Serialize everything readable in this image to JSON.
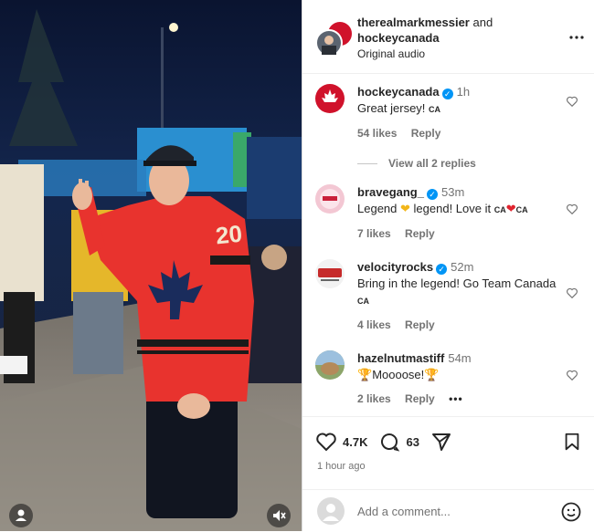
{
  "header": {
    "user1": "therealmarkmessier",
    "joiner": "and",
    "user2": "hockeycanada",
    "audio": "Original audio",
    "more_icon": "more-horizontal-icon"
  },
  "comments": [
    {
      "user": "hockeycanada",
      "verified": true,
      "time": "1h",
      "text": "Great jersey!",
      "flag": "CA",
      "likes": "54 likes",
      "reply": "Reply",
      "view_replies": "View all 2 replies"
    },
    {
      "user": "bravegang_",
      "verified": true,
      "time": "53m",
      "text_a": "Legend",
      "text_b": "legend! Love it",
      "flag": "CA",
      "likes": "7 likes",
      "reply": "Reply"
    },
    {
      "user": "velocityrocks",
      "verified": true,
      "time": "52m",
      "text": "Bring in the legend! Go Team Canada",
      "flag": "CA",
      "likes": "4 likes",
      "reply": "Reply"
    },
    {
      "user": "hazelnutmastiff",
      "verified": false,
      "time": "54m",
      "text": "Moooose!",
      "likes": "2 likes",
      "reply": "Reply",
      "more": "•••"
    }
  ],
  "actions": {
    "like_count": "4.7K",
    "comment_count": "63",
    "time_ago": "1 hour ago"
  },
  "composer": {
    "placeholder": "Add a comment..."
  },
  "media": {
    "jersey_number": "20"
  },
  "colors": {
    "verified": "#0095f6",
    "meta": "#737373",
    "jersey_red": "#e8332e",
    "maple_blue": "#1a2c5c"
  }
}
